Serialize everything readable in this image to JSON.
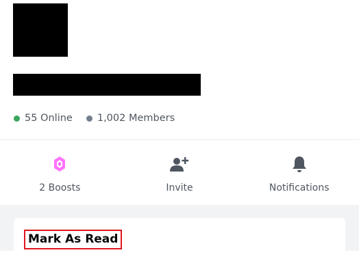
{
  "server": {
    "online_text": "55 Online",
    "members_text": "1,002 Members",
    "online_color": "#3ba55d",
    "members_color": "#747f8d"
  },
  "actions": [
    {
      "label": "2 Boosts",
      "icon": "boost-gem-icon",
      "color": "#ff73fa"
    },
    {
      "label": "Invite",
      "icon": "add-person-icon",
      "color": "#4f5660"
    },
    {
      "label": "Notifications",
      "icon": "bell-icon",
      "color": "#4f5660"
    }
  ],
  "menu": {
    "mark_as_read": "Mark As Read"
  }
}
